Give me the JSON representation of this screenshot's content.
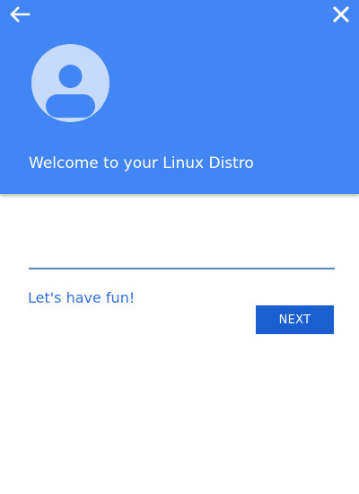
{
  "header": {
    "title": "Welcome to your Linux Distro",
    "background_color": "#4285f4",
    "back_icon": "arrow-left-icon",
    "close_icon": "close-icon",
    "avatar_icon": "account-circle-icon"
  },
  "form": {
    "input_value": "",
    "message": "Let's have fun!",
    "next_label": "NEXT",
    "accent_color": "#1a5fd1"
  }
}
